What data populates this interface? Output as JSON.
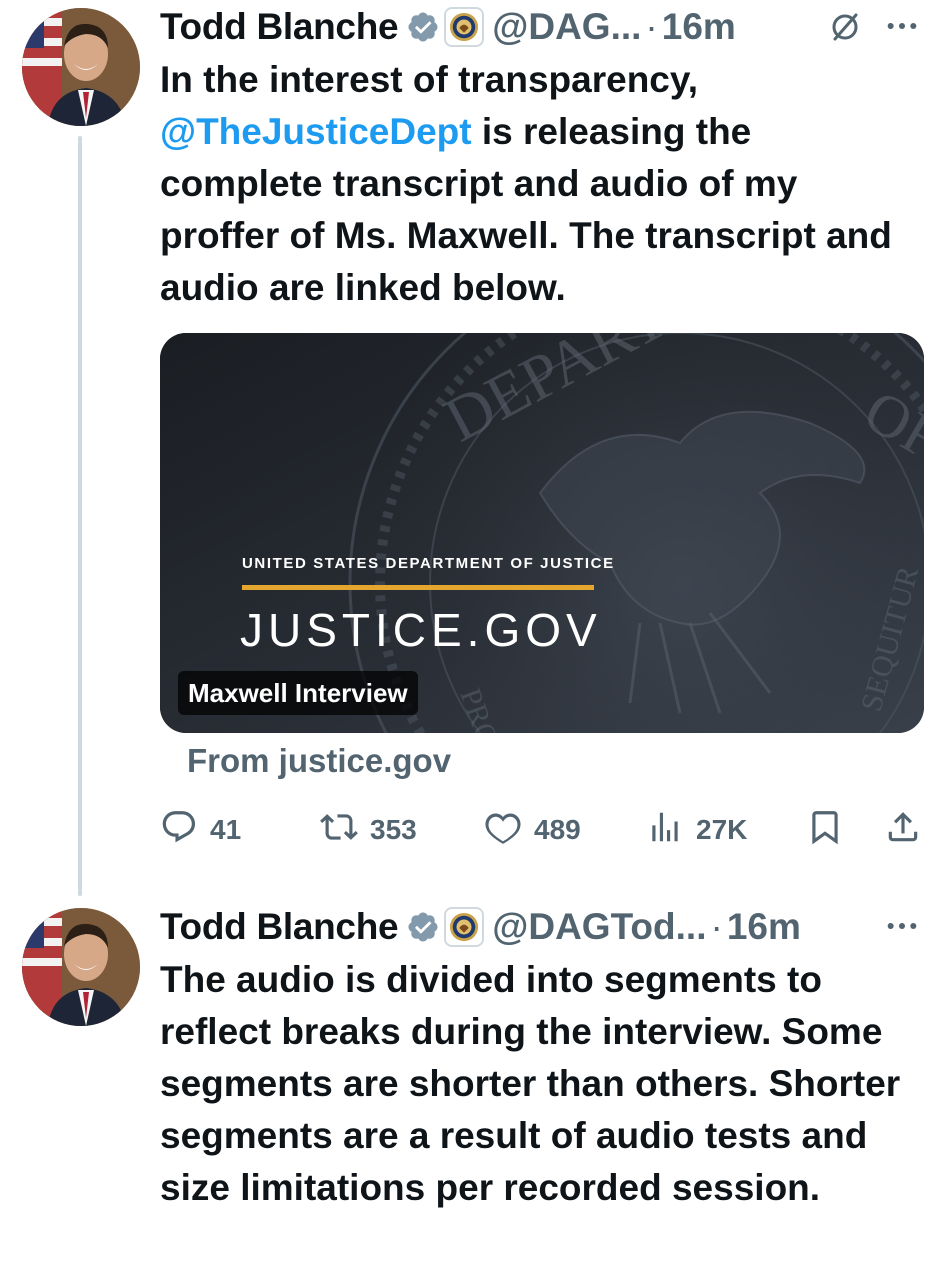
{
  "tweets": [
    {
      "display_name": "Todd Blanche",
      "handle": "@DAG...",
      "separator": "·",
      "time": "16m",
      "text_before": "In the interest of transparency, ",
      "mention": "@TheJusticeDept",
      "text_after": " is releasing the complete transcript and audio of my proffer of Ms. Maxwell. The transcript and audio are linked below.",
      "card": {
        "kicker": "UNITED STATES DEPARTMENT OF JUSTICE",
        "brand": "JUSTICE.GOV",
        "title": "Maxwell Interview",
        "seal_text_top": "DEPARTMENT OF JUSTICE",
        "seal_text_right": "SEQUITUR",
        "seal_text_left": "PRO"
      },
      "from": "From justice.gov",
      "stats": {
        "replies": "41",
        "reposts": "353",
        "likes": "489",
        "views": "27K"
      }
    },
    {
      "display_name": "Todd Blanche",
      "handle": "@DAGTod...",
      "separator": "·",
      "time": "16m",
      "text": "The audio is divided into segments to reflect breaks during the interview. Some segments are shorter than others. Shorter segments are a result of audio tests and size limitations per recorded session."
    }
  ],
  "colors": {
    "accent": "#1d9bf0",
    "muted": "#536471",
    "text": "#0f1419",
    "card_rule": "#e5a62f"
  },
  "icons": [
    "verified-badge-icon",
    "doj-seal-icon",
    "grok-icon",
    "more-icon",
    "reply-icon",
    "repost-icon",
    "like-icon",
    "views-icon",
    "bookmark-icon",
    "share-icon"
  ]
}
